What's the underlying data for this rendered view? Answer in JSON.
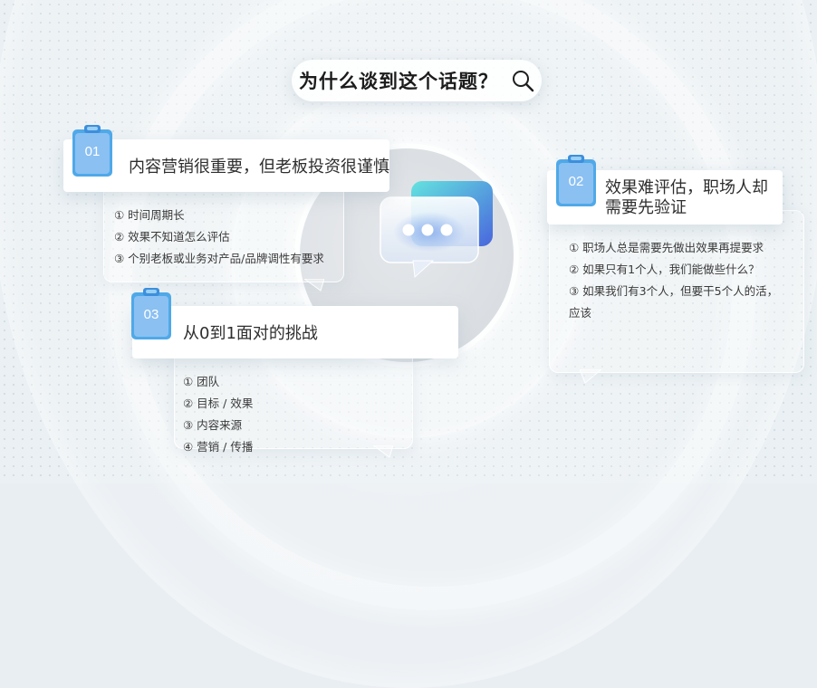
{
  "title": "为什么谈到这个话题？",
  "icons": {
    "search": "search-icon",
    "chat": "chat-bubble-icon",
    "clipboard": "clipboard-icon"
  },
  "colors": {
    "accent_start": "#62dfe0",
    "accent_end": "#4a6fe0",
    "badge_bg": "#6aa6ee"
  },
  "cards": [
    {
      "number": "01",
      "heading": "内容营销很重要，但老板投资很谨慎",
      "items": [
        "① 时间周期长",
        "② 效果不知道怎么评估",
        "③ 个别老板或业务对产品/品牌调性有要求"
      ]
    },
    {
      "number": "02",
      "heading_line1": "效果难评估，职场人却",
      "heading_line2": "需要先验证",
      "items": [
        "① 职场人总是需要先做出效果再提要求",
        "② 如果只有1个人，我们能做些什么？",
        "③  如果我们有3个人，但要干5个人的活，",
        "应该"
      ]
    },
    {
      "number": "03",
      "heading": "从0到1面对的挑战",
      "items": [
        "① 团队",
        "② 目标 / 效果",
        "③ 内容来源",
        "④ 营销 / 传播"
      ]
    }
  ]
}
